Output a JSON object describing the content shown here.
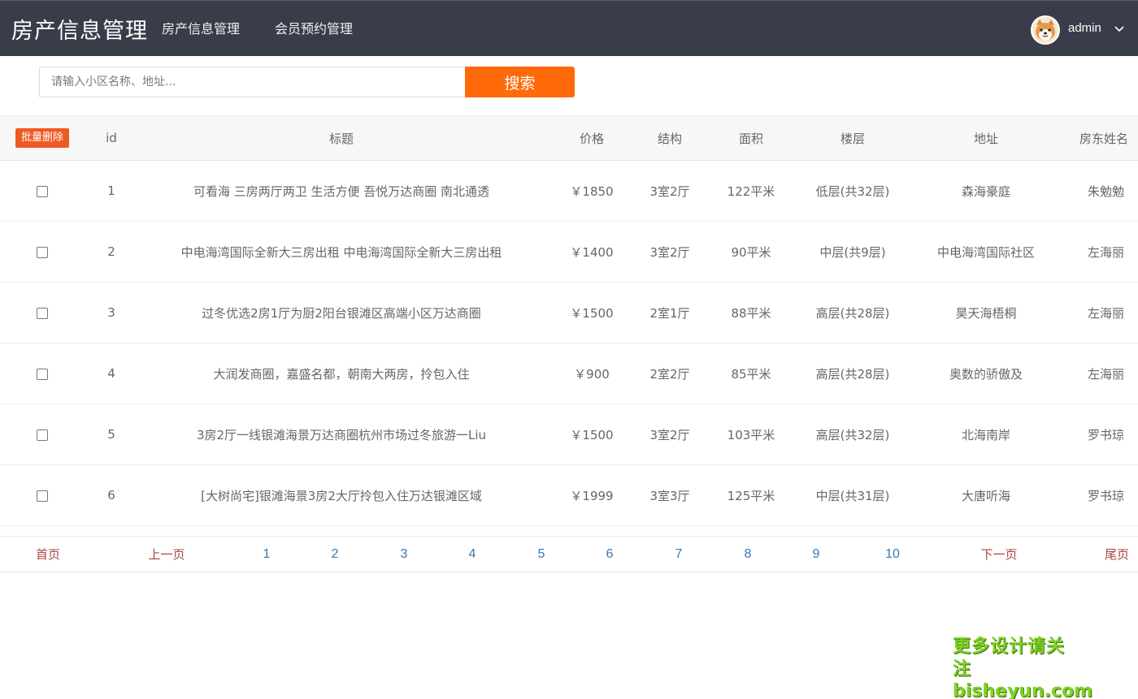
{
  "header": {
    "title": "房产信息管理",
    "nav": [
      "房产信息管理",
      "会员预约管理"
    ],
    "user": "admin"
  },
  "search": {
    "placeholder": "请输入小区名称、地址...",
    "button": "搜索"
  },
  "table": {
    "batch_delete": "批量删除",
    "columns": [
      "id",
      "标题",
      "价格",
      "结构",
      "面积",
      "楼层",
      "地址",
      "房东姓名"
    ],
    "rows": [
      {
        "id": "1",
        "title": "可看海 三房两厅两卫 生活方便 吾悦万达商圈 南北通透",
        "price": "￥1850",
        "layout": "3室2厅",
        "area": "122平米",
        "floor": "低层(共32层)",
        "address": "森海豪庭",
        "owner": "朱勉勉"
      },
      {
        "id": "2",
        "title": "中电海湾国际全新大三房出租 中电海湾国际全新大三房出租",
        "price": "￥1400",
        "layout": "3室2厅",
        "area": "90平米",
        "floor": "中层(共9层)",
        "address": "中电海湾国际社区",
        "owner": "左海丽"
      },
      {
        "id": "3",
        "title": "过冬优选2房1厅为厨2阳台银滩区高端小区万达商圈",
        "price": "￥1500",
        "layout": "2室1厅",
        "area": "88平米",
        "floor": "高层(共28层)",
        "address": "昊天海梧桐",
        "owner": "左海丽"
      },
      {
        "id": "4",
        "title": "大润发商圈，嘉盛名都，朝南大两房，拎包入住",
        "price": "￥900",
        "layout": "2室2厅",
        "area": "85平米",
        "floor": "高层(共28层)",
        "address": "奥数的骄傲及",
        "owner": "左海丽"
      },
      {
        "id": "5",
        "title": "3房2厅一线银滩海景万达商圈杭州市场过冬旅游一Liu",
        "price": "￥1500",
        "layout": "3室2厅",
        "area": "103平米",
        "floor": "高层(共32层)",
        "address": "北海南岸",
        "owner": "罗书琼"
      },
      {
        "id": "6",
        "title": "[大树尚宅]银滩海景3房2大厅拎包入住万达银滩区域",
        "price": "￥1999",
        "layout": "3室3厅",
        "area": "125平米",
        "floor": "中层(共31层)",
        "address": "大唐听海",
        "owner": "罗书琼"
      }
    ]
  },
  "pagination": {
    "first": "首页",
    "prev": "上一页",
    "pages": [
      "1",
      "2",
      "3",
      "4",
      "5",
      "6",
      "7",
      "8",
      "9",
      "10"
    ],
    "next": "下一页",
    "last": "尾页"
  },
  "watermark": {
    "line1": "更多设计请关注",
    "line2": "bisheyun.com"
  },
  "colors": {
    "header_bg": "#393d49",
    "search_button": "#ff6a0b",
    "batch_delete": "#ee5a24",
    "pager_text": "#a94442",
    "pager_number": "#337ab7",
    "watermark": "#7ed321"
  },
  "icons": {
    "avatar": "shiba-dog-avatar",
    "user_menu": "chevron-down-icon",
    "row_select": "checkbox"
  }
}
